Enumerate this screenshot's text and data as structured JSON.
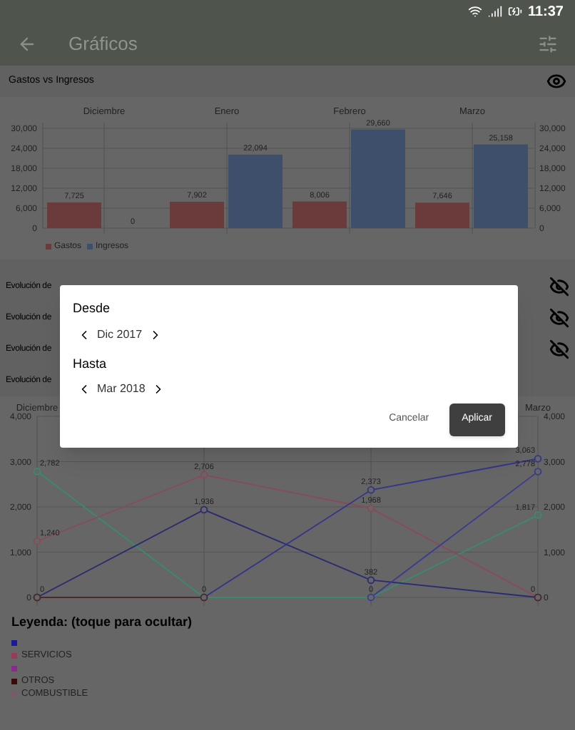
{
  "status_bar": {
    "time": "11:37"
  },
  "app_bar": {
    "title": "Gráficos"
  },
  "bar_section": {
    "title": "Gastos vs Ingresos",
    "visible": true,
    "chart_data": {
      "type": "bar",
      "categories": [
        "Diciembre",
        "Enero",
        "Febrero",
        "Marzo"
      ],
      "ylim": [
        0,
        30000
      ],
      "grid": true,
      "yticks": [
        {
          "value": 0,
          "label": "0"
        },
        {
          "value": 6000,
          "label": "6,000"
        },
        {
          "value": 12000,
          "label": "12,000"
        },
        {
          "value": 18000,
          "label": "18,000"
        },
        {
          "value": 24000,
          "label": "24,000"
        },
        {
          "value": 30000,
          "label": "30,000"
        }
      ],
      "series": [
        {
          "name": "Gastos",
          "color": "#6b3a3a",
          "values": [
            7725,
            7902,
            8006,
            7646
          ]
        },
        {
          "name": "Ingresos",
          "color": "#3e4f6b",
          "values": [
            0,
            22094,
            29660,
            25158
          ]
        }
      ],
      "value_labels": [
        [
          "7,725",
          "7,902",
          "8,006",
          "7,646"
        ],
        [
          "0",
          "22,094",
          "29,660",
          "25,158"
        ]
      ]
    }
  },
  "sections": [
    {
      "title": "Evolución de",
      "visible": false
    },
    {
      "title": "Evolución de",
      "visible": false
    },
    {
      "title": "Evolución de",
      "visible": false
    },
    {
      "title": "Evolución de"
    }
  ],
  "line_chart": {
    "chart_data": {
      "type": "line",
      "categories": [
        "Diciembre",
        null,
        null,
        "Marzo"
      ],
      "ylim": [
        0,
        4000
      ],
      "grid": true,
      "yticks": [
        {
          "value": 0,
          "label": "0"
        },
        {
          "value": 1000,
          "label": "1,000"
        },
        {
          "value": 2000,
          "label": "2,000"
        },
        {
          "value": 3000,
          "label": "3,000"
        },
        {
          "value": 4000,
          "label": "4,000"
        }
      ],
      "series": [
        {
          "color": "#3a8a6e",
          "marker": "circle",
          "values": [
            2782,
            0,
            0,
            1817
          ]
        },
        {
          "color": "#8a4a5a",
          "marker": "circle",
          "values": [
            1240,
            2706,
            1968,
            0
          ]
        },
        {
          "color": "#2a2a70",
          "marker": "circle",
          "values": [
            0,
            1936,
            382,
            0
          ]
        },
        {
          "color": "#3a3a90",
          "marker": "circle",
          "values": [
            null,
            null,
            0,
            2778
          ]
        },
        {
          "color": "#34348a",
          "marker": "circle",
          "values": [
            0,
            0,
            2373,
            3063
          ]
        },
        {
          "color": "#4a2a2a",
          "marker": "circle",
          "values": [
            0,
            0,
            null,
            0
          ]
        }
      ],
      "value_labels": [
        [
          "2,782",
          null,
          null,
          "1,817"
        ],
        [
          "1,240",
          "2,706",
          "1,968",
          null
        ],
        [
          "0",
          "1,936",
          "382",
          "0"
        ],
        [
          null,
          null,
          "0",
          "2,778"
        ],
        [
          null,
          "0",
          "2,373",
          "3,063"
        ],
        [
          null,
          null,
          null,
          null
        ]
      ]
    }
  },
  "legend": {
    "title": "Leyenda: (toque para ocultar)",
    "items": [
      {
        "color": "#1a1a9a"
      },
      {
        "color": "#9a3a5a",
        "label": "SERVICIOS"
      },
      {
        "color": "#8a2a8a"
      },
      {
        "color": "#3a0a0a",
        "label": "OTROS"
      },
      {
        "color": "#7a5a6a",
        "label": "COMBUSTIBLE"
      }
    ]
  },
  "dialog": {
    "from": {
      "label": "Desde",
      "value": "Dic 2017"
    },
    "to": {
      "label": "Hasta",
      "value": "Mar 2018"
    },
    "buttons": [
      {
        "label": "Cancelar",
        "kind": "text"
      },
      {
        "label": "Aplicar",
        "kind": "filled"
      }
    ]
  }
}
